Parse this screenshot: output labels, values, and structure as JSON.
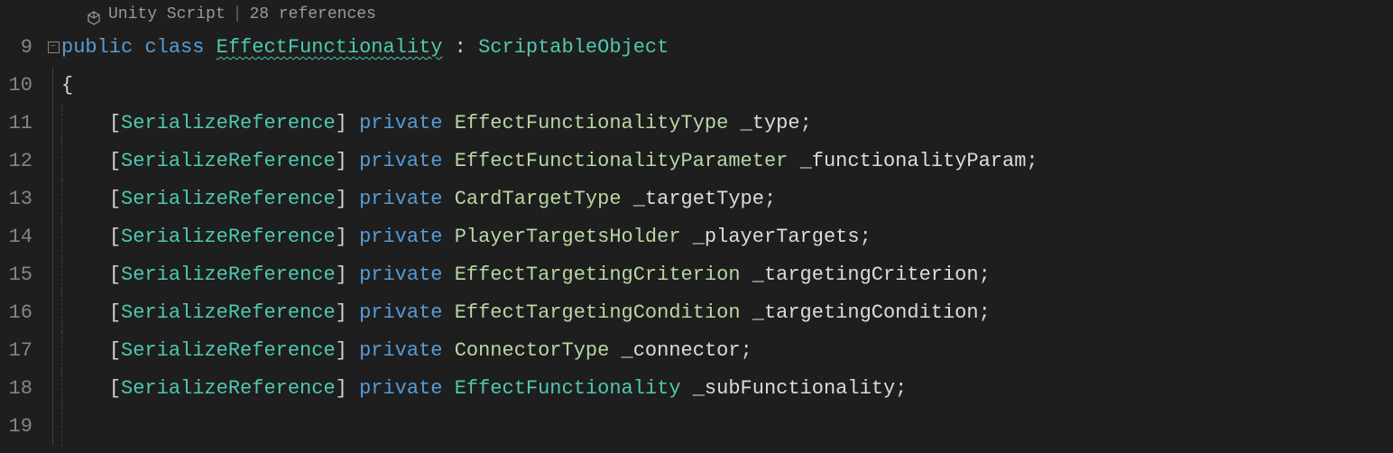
{
  "codelens": {
    "unity_script": "Unity Script",
    "separator": "|",
    "references": "28 references"
  },
  "line_numbers": [
    "9",
    "10",
    "11",
    "12",
    "13",
    "14",
    "15",
    "16",
    "17",
    "18",
    "19"
  ],
  "fold_icon": "−",
  "code": {
    "line9": {
      "public": "public",
      "class": "class",
      "name": "EffectFunctionality",
      "colon": " : ",
      "base": "ScriptableObject"
    },
    "line10": {
      "brace": "{"
    },
    "fields": [
      {
        "attr": "SerializeReference",
        "private": "private",
        "type": "EffectFunctionalityType",
        "name": "_type"
      },
      {
        "attr": "SerializeReference",
        "private": "private",
        "type": "EffectFunctionalityParameter",
        "name": "_functionalityParam"
      },
      {
        "attr": "SerializeReference",
        "private": "private",
        "type": "CardTargetType",
        "name": "_targetType"
      },
      {
        "attr": "SerializeReference",
        "private": "private",
        "type": "PlayerTargetsHolder",
        "name": "_playerTargets"
      },
      {
        "attr": "SerializeReference",
        "private": "private",
        "type": "EffectTargetingCriterion",
        "name": "_targetingCriterion"
      },
      {
        "attr": "SerializeReference",
        "private": "private",
        "type": "EffectTargetingCondition",
        "name": "_targetingCondition"
      },
      {
        "attr": "SerializeReference",
        "private": "private",
        "type": "ConnectorType",
        "name": "_connector"
      },
      {
        "attr": "SerializeReference",
        "private": "private",
        "type": "EffectFunctionality",
        "name": "_subFunctionality"
      }
    ]
  }
}
